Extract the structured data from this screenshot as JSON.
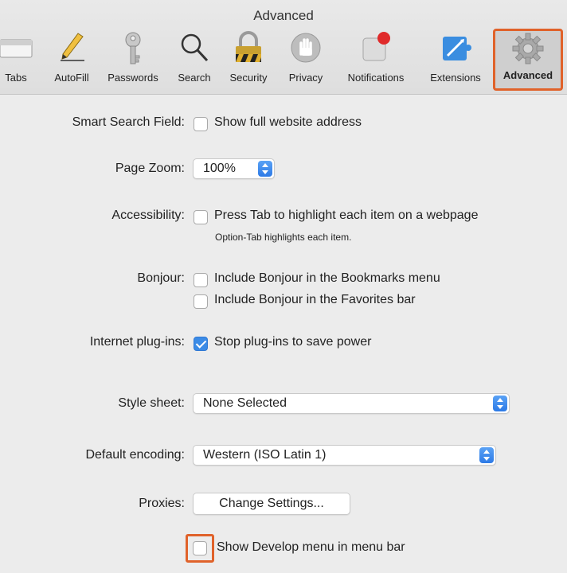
{
  "window": {
    "title": "Advanced"
  },
  "toolbar": {
    "tabs": [
      {
        "label": "Tabs",
        "icon": "tabs-icon"
      },
      {
        "label": "AutoFill",
        "icon": "pencil-icon"
      },
      {
        "label": "Passwords",
        "icon": "key-icon"
      },
      {
        "label": "Search",
        "icon": "magnifier-icon"
      },
      {
        "label": "Security",
        "icon": "lock-icon"
      },
      {
        "label": "Privacy",
        "icon": "hand-icon"
      },
      {
        "label": "Notifications",
        "icon": "notifications-icon"
      },
      {
        "label": "Extensions",
        "icon": "puzzle-icon"
      },
      {
        "label": "Advanced",
        "icon": "gear-icon",
        "selected": true
      }
    ]
  },
  "settings": {
    "smart_search": {
      "label": "Smart Search Field:",
      "option": "Show full website address",
      "checked": false
    },
    "page_zoom": {
      "label": "Page Zoom:",
      "value": "100%"
    },
    "accessibility": {
      "label": "Accessibility:",
      "option": "Press Tab to highlight each item on a webpage",
      "hint": "Option-Tab highlights each item.",
      "checked": false
    },
    "bonjour": {
      "label": "Bonjour:",
      "options": [
        {
          "text": "Include Bonjour in the Bookmarks menu",
          "checked": false
        },
        {
          "text": "Include Bonjour in the Favorites bar",
          "checked": false
        }
      ]
    },
    "plugins": {
      "label": "Internet plug-ins:",
      "option": "Stop plug-ins to save power",
      "checked": true
    },
    "style_sheet": {
      "label": "Style sheet:",
      "value": "None Selected"
    },
    "encoding": {
      "label": "Default encoding:",
      "value": "Western (ISO Latin 1)"
    },
    "proxies": {
      "label": "Proxies:",
      "button": "Change Settings..."
    },
    "develop": {
      "option": "Show Develop menu in menu bar",
      "checked": false
    }
  },
  "colors": {
    "highlight": "#e0622a",
    "accent": "#3b8be6"
  }
}
